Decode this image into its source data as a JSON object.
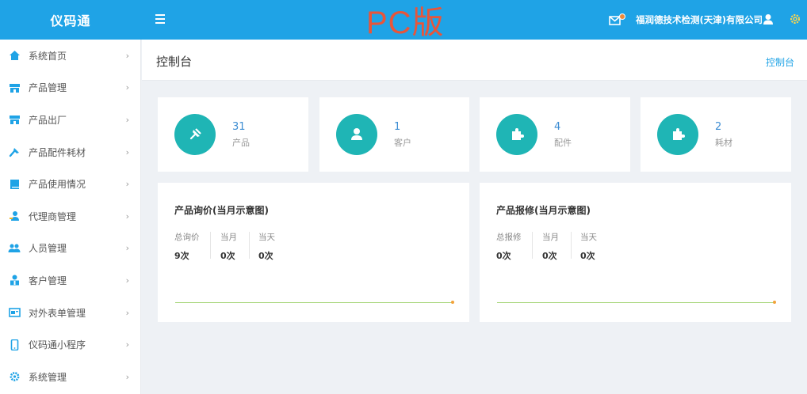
{
  "app": {
    "title": "仪码通",
    "banner": "PC版"
  },
  "header": {
    "company": "福润德技术检测(天津)有限公司"
  },
  "sidebar": {
    "items": [
      {
        "label": "系统首页",
        "icon": "home-icon"
      },
      {
        "label": "产品管理",
        "icon": "store-icon"
      },
      {
        "label": "产品出厂",
        "icon": "store-icon"
      },
      {
        "label": "产品配件耗材",
        "icon": "wrench-icon"
      },
      {
        "label": "产品使用情况",
        "icon": "book-icon"
      },
      {
        "label": "代理商管理",
        "icon": "agent-icon"
      },
      {
        "label": "人员管理",
        "icon": "users-icon"
      },
      {
        "label": "客户管理",
        "icon": "customer-icon"
      },
      {
        "label": "对外表单管理",
        "icon": "form-icon"
      },
      {
        "label": "仪码通小程序",
        "icon": "phone-icon"
      },
      {
        "label": "系统管理",
        "icon": "gear-icon"
      }
    ]
  },
  "page": {
    "title": "控制台",
    "breadcrumb": "控制台"
  },
  "stats": [
    {
      "value": "31",
      "label": "产品",
      "icon": "pin-icon"
    },
    {
      "value": "1",
      "label": "客户",
      "icon": "user-icon"
    },
    {
      "value": "4",
      "label": "配件",
      "icon": "puzzle-icon"
    },
    {
      "value": "2",
      "label": "耗材",
      "icon": "puzzle-icon"
    }
  ],
  "panels": [
    {
      "title": "产品询价(当月示意图)",
      "metrics": [
        {
          "label": "总询价",
          "value": "9次"
        },
        {
          "label": "当月",
          "value": "0次"
        },
        {
          "label": "当天",
          "value": "0次"
        }
      ]
    },
    {
      "title": "产品报修(当月示意图)",
      "metrics": [
        {
          "label": "总报修",
          "value": "0次"
        },
        {
          "label": "当月",
          "value": "0次"
        },
        {
          "label": "当天",
          "value": "0次"
        }
      ]
    }
  ],
  "colors": {
    "primary": "#1fa3e6",
    "teal": "#1fb5b5",
    "banner": "#e8553a",
    "trend": "#a6d67a"
  }
}
